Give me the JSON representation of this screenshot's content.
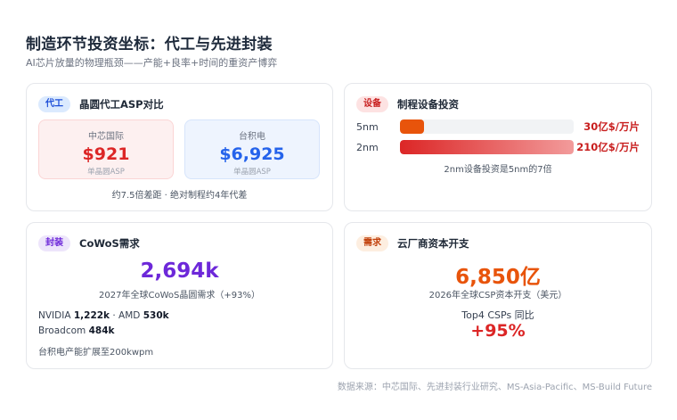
{
  "header": {
    "title": "制造环节投资坐标：代工与先进封装",
    "subtitle": "AI芯片放量的物理瓶颈——产能+良率+时间的重资产博弈"
  },
  "foundry": {
    "tag": "代工",
    "title": "晶圆代工ASP对比",
    "smic": {
      "name": "中芯国际",
      "value": "$921",
      "unit": "单晶圆ASP"
    },
    "tsmc": {
      "name": "台积电",
      "value": "$6,925",
      "unit": "单晶圆ASP"
    },
    "note": "约7.5倍差距 · 绝对制程约4年代差"
  },
  "equipment": {
    "tag": "设备",
    "title": "制程设备投资",
    "rows": [
      {
        "label": "5nm",
        "value": "30亿$/万片",
        "fraction": 0.14
      },
      {
        "label": "2nm",
        "value": "210亿$/万片",
        "fraction": 1.0
      }
    ],
    "note": "2nm设备投资是5nm的7倍"
  },
  "packaging": {
    "tag": "封装",
    "title": "CoWoS需求",
    "big_value": "2,694k",
    "big_sub": "2027年全球CoWoS晶圆需求（+93%）",
    "line1_a": "NVIDIA ",
    "line1_b": "1,222k",
    "line1_c": " · AMD ",
    "line1_d": "530k",
    "line2_a": "Broadcom ",
    "line2_b": "484k",
    "foot": "台积电产能扩展至200kwpm"
  },
  "demand": {
    "tag": "需求",
    "title": "云厂商资本开支",
    "big_value": "6,850亿",
    "big_sub": "2026年全球CSP资本开支（美元）",
    "label": "Top4 CSPs 同比",
    "pct": "+95%"
  },
  "source": "数据来源：中芯国际、先进封装行业研究、MS-Asia-Pacific、MS-Build Future"
}
